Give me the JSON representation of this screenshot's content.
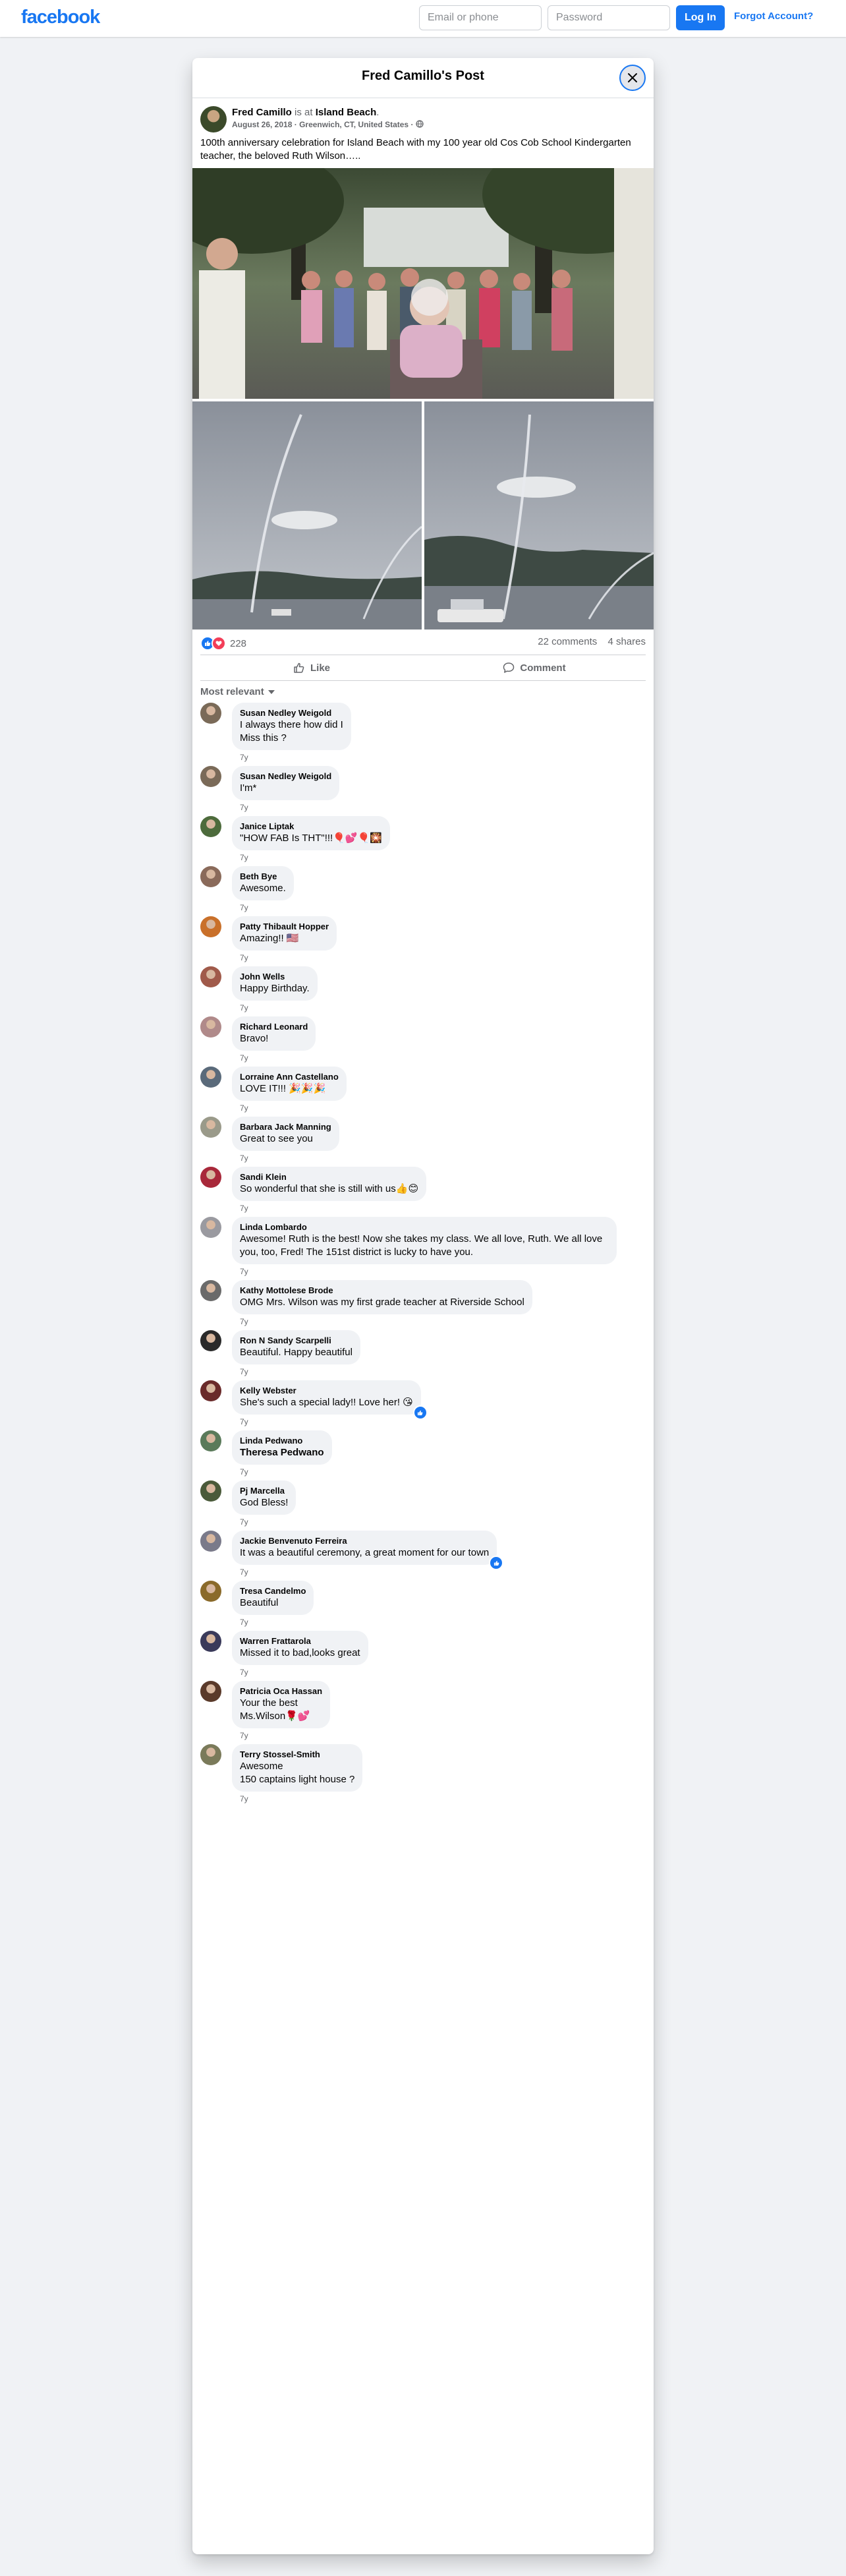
{
  "topbar": {
    "logo": "facebook",
    "email_placeholder": "Email or phone",
    "password_placeholder": "Password",
    "login_label": "Log In",
    "forgot_label": "Forgot Account?"
  },
  "modal": {
    "title": "Fred Camillo's Post"
  },
  "post": {
    "author": "Fred Camillo",
    "is_at": "is at",
    "place": "Island Beach",
    "place_suffix": ".",
    "date": "August 26, 2018",
    "location": "Greenwich, CT, United States",
    "text": "100th anniversary celebration for Island Beach with my 100 year old Cos Cob School Kindergarten teacher, the beloved Ruth Wilson…..",
    "reaction_count": "228",
    "comments_count": "22 comments",
    "shares_count": "4 shares",
    "like_label": "Like",
    "comment_label": "Comment",
    "sort_label": "Most relevant"
  },
  "comments": [
    {
      "name": "Susan Nedley Weigold",
      "text": "I always there how did I\nMiss this ?",
      "time": "7y",
      "avatar": "#7a6a58"
    },
    {
      "name": "Susan Nedley Weigold",
      "text": "I'm*",
      "time": "7y",
      "avatar": "#7a6a58"
    },
    {
      "name": "Janice Liptak",
      "text": "\"HOW FAB Is THT\"!!!🎈💕🎈🎇",
      "time": "7y",
      "avatar": "#4d6b3c"
    },
    {
      "name": "Beth Bye",
      "text": "Awesome.",
      "time": "7y",
      "avatar": "#8a6a5a"
    },
    {
      "name": "Patty Thibault Hopper",
      "text": "Amazing!! 🇺🇸",
      "time": "7y",
      "avatar": "#c9702a"
    },
    {
      "name": "John Wells",
      "text": "Happy Birthday.",
      "time": "7y",
      "avatar": "#a05a4a"
    },
    {
      "name": "Richard Leonard",
      "text": "Bravo!",
      "time": "7y",
      "avatar": "#b08a8a"
    },
    {
      "name": "Lorraine Ann Castellano",
      "text": "LOVE IT!!! 🎉🎉🎉",
      "time": "7y",
      "avatar": "#5a6a7a"
    },
    {
      "name": "Barbara Jack Manning",
      "text": "Great to see you",
      "time": "7y",
      "avatar": "#9a9a8a"
    },
    {
      "name": "Sandi Klein",
      "text": "So wonderful that she is still with us👍😊",
      "time": "7y",
      "avatar": "#a8283a"
    },
    {
      "name": "Linda Lombardo",
      "text": "Awesome! Ruth is the best! Now she takes my class. We all love, Ruth. We all love you, too, Fred! The 151st district is lucky to have you.",
      "time": "7y",
      "avatar": "#9a9aa0"
    },
    {
      "name": "Kathy Mottolese Brode",
      "text": "OMG Mrs. Wilson was my first grade teacher at Riverside School",
      "time": "7y",
      "avatar": "#6a6a6a"
    },
    {
      "name": "Ron N Sandy Scarpelli",
      "text": "Beautiful. Happy beautiful",
      "time": "7y",
      "avatar": "#2a2a2a"
    },
    {
      "name": "Kelly Webster",
      "text": "She's such a special lady!! Love her! 😘",
      "time": "7y",
      "avatar": "#6a2a2a",
      "reaction": true
    },
    {
      "name": "Linda Pedwano",
      "text": "Theresa Pedwano",
      "time": "7y",
      "avatar": "#5a7a5a",
      "tag": true
    },
    {
      "name": "Pj Marcella",
      "text": "God Bless!",
      "time": "7y",
      "avatar": "#4a5a3a"
    },
    {
      "name": "Jackie Benvenuto Ferreira",
      "text": "It was a beautiful ceremony, a great moment for our town",
      "time": "7y",
      "avatar": "#7a7a8a",
      "reaction": true
    },
    {
      "name": "Tresa Candelmo",
      "text": "Beautiful",
      "time": "7y",
      "avatar": "#8a6a2a"
    },
    {
      "name": "Warren Frattarola",
      "text": "Missed it to bad,looks great",
      "time": "7y",
      "avatar": "#3a3a5a"
    },
    {
      "name": "Patricia Oca Hassan",
      "text": "Your the best\nMs.Wilson🌹💕",
      "time": "7y",
      "avatar": "#5a3a2a"
    },
    {
      "name": "Terry Stossel-Smith",
      "text": "Awesome\n150 captains light house ?",
      "time": "7y",
      "avatar": "#7a7a5a"
    }
  ],
  "colors": {
    "brand": "#1877f2",
    "background": "#f0f2f5",
    "bubble": "#f0f2f5",
    "love": "#f33e58"
  }
}
